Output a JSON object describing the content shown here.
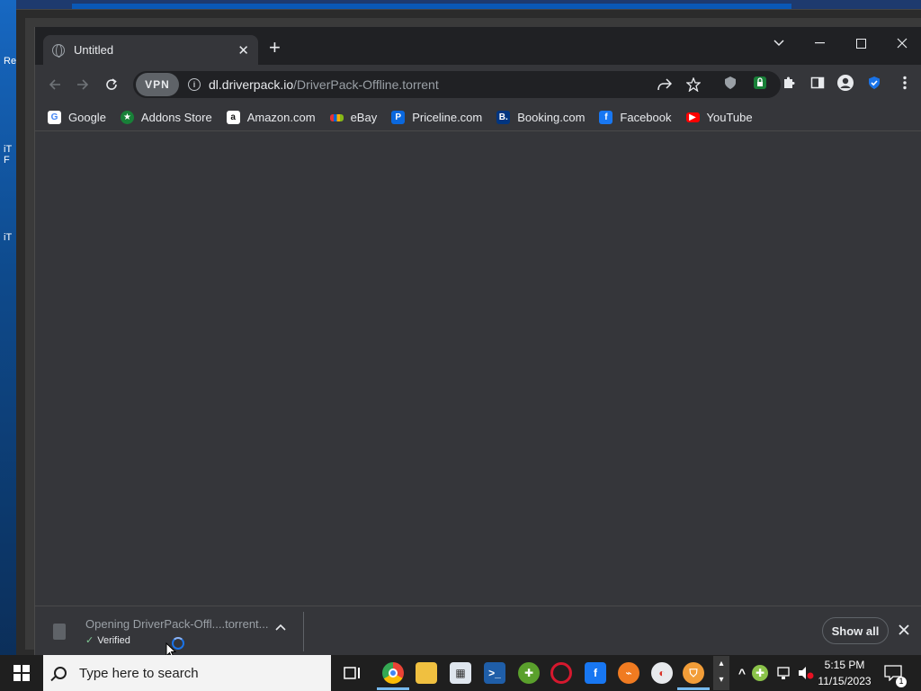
{
  "browser": {
    "tab": {
      "title": "Untitled"
    },
    "new_tab_symbol": "+",
    "address": {
      "vpn_label": "VPN",
      "host": "dl.driverpack.io",
      "path": "/DriverPack-Offline.torrent"
    },
    "bookmarks": [
      {
        "label": "Google",
        "icon": "google-icon",
        "color": "#4285f4"
      },
      {
        "label": "Addons Store",
        "icon": "addons-store-icon",
        "color": "#188038"
      },
      {
        "label": "Amazon.com",
        "icon": "amazon-icon",
        "color": "#ffffff"
      },
      {
        "label": "eBay",
        "icon": "ebay-icon",
        "color": "#e53238"
      },
      {
        "label": "Priceline.com",
        "icon": "priceline-icon",
        "color": "#0a68de"
      },
      {
        "label": "Booking.com",
        "icon": "booking-icon",
        "color": "#003580"
      },
      {
        "label": "Facebook",
        "icon": "facebook-icon",
        "color": "#1877f2"
      },
      {
        "label": "YouTube",
        "icon": "youtube-icon",
        "color": "#ff0000"
      }
    ]
  },
  "download": {
    "filename": "Opening DriverPack-Offl....torrent...",
    "status": "Verified",
    "show_all_label": "Show all"
  },
  "taskbar": {
    "search_placeholder": "Type here to search",
    "time": "5:15 PM",
    "date": "11/15/2023",
    "notification_count": "1"
  },
  "colors": {
    "accent": "#1a73e8",
    "verified": "#81c995",
    "frame": "#202124",
    "toolbar": "#35363a"
  }
}
